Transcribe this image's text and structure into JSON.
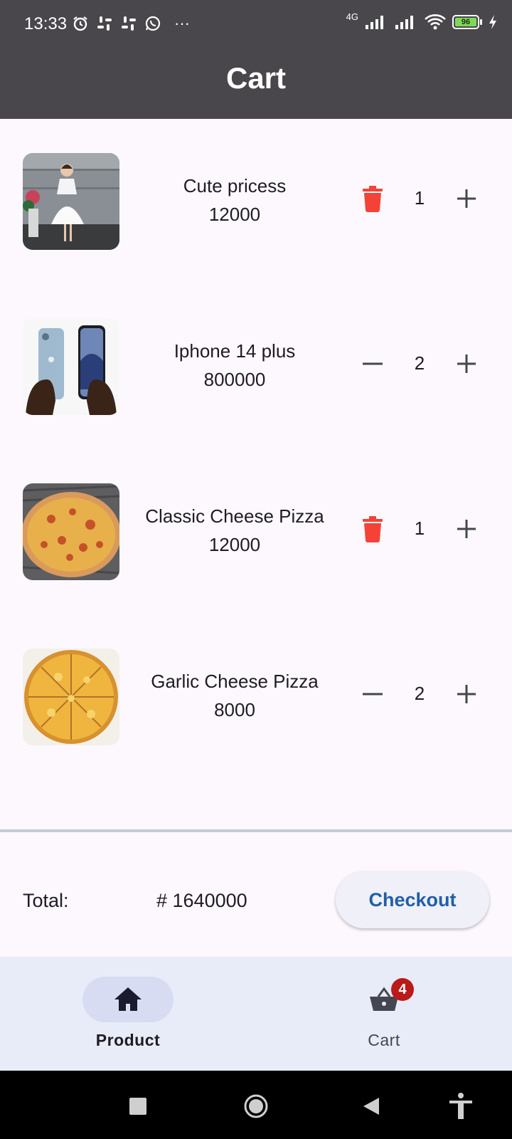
{
  "status_bar": {
    "time": "13:33",
    "network": "4G",
    "battery": "96",
    "more": "···"
  },
  "app_bar": {
    "title": "Cart"
  },
  "cart": {
    "items": [
      {
        "name": "Cute pricess",
        "price": "12000",
        "quantity": "1",
        "left_action": "delete",
        "image": "girl-dress-photo"
      },
      {
        "name": "Iphone 14 plus",
        "price": "800000",
        "quantity": "2",
        "left_action": "decrement",
        "image": "iphone-photo"
      },
      {
        "name": "Classic Cheese Pizza",
        "price": "12000",
        "quantity": "1",
        "left_action": "delete",
        "image": "cheese-pizza-photo"
      },
      {
        "name": "Garlic Cheese Pizza",
        "price": "8000",
        "quantity": "2",
        "left_action": "decrement",
        "image": "garlic-pizza-photo"
      }
    ]
  },
  "summary": {
    "total_label": "Total:",
    "total_value": "# 1640000",
    "checkout_label": "Checkout"
  },
  "bottom_nav": {
    "items": [
      {
        "label": "Product",
        "icon": "home-icon",
        "active": true
      },
      {
        "label": "Cart",
        "icon": "basket-icon",
        "active": false,
        "badge": "4"
      }
    ]
  },
  "colors": {
    "app_bar": "#49474c",
    "delete_icon": "#f44336",
    "checkout_text": "#1f5fa8",
    "badge": "#ba1a1a",
    "nav_background": "#e8ecf8"
  }
}
